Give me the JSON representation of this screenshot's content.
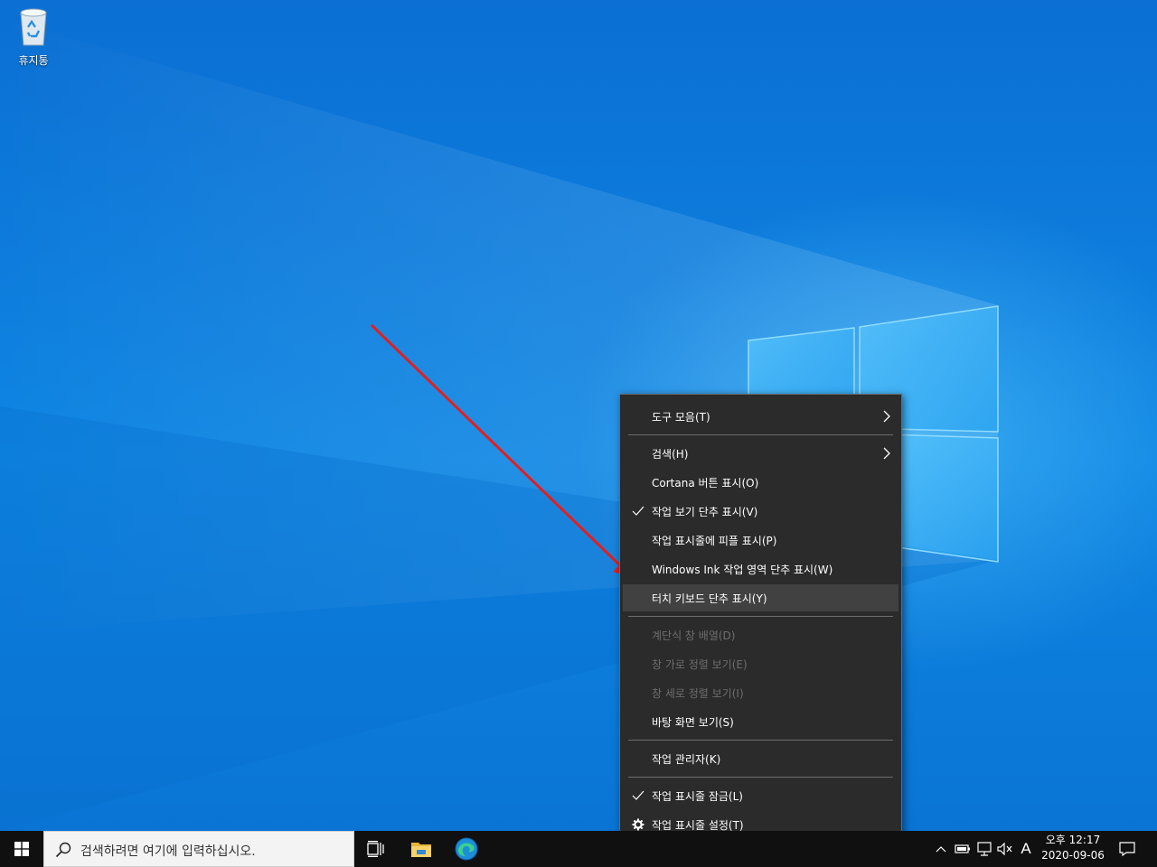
{
  "desktop": {
    "recycle_bin_label": "휴지통"
  },
  "context_menu": {
    "items": [
      {
        "label": "도구 모음(T)",
        "submenu": true
      },
      {
        "label": "검색(H)",
        "submenu": true
      },
      {
        "label": "Cortana 버튼 표시(O)"
      },
      {
        "label": "작업 보기 단추 표시(V)",
        "checked": true
      },
      {
        "label": "작업 표시줄에 피플 표시(P)"
      },
      {
        "label": "Windows Ink 작업 영역 단추 표시(W)"
      },
      {
        "label": "터치 키보드 단추 표시(Y)",
        "highlighted": true
      },
      {
        "label": "계단식 창 배열(D)",
        "disabled": true
      },
      {
        "label": "창 가로 정렬 보기(E)",
        "disabled": true
      },
      {
        "label": "창 세로 정렬 보기(I)",
        "disabled": true
      },
      {
        "label": "바탕 화면 보기(S)"
      },
      {
        "label": "작업 관리자(K)"
      },
      {
        "label": "작업 표시줄 잠금(L)",
        "checked": true
      },
      {
        "label": "작업 표시줄 설정(T)",
        "icon": "gear-icon"
      }
    ]
  },
  "taskbar": {
    "search_placeholder": "검색하려면 여기에 입력하십시오.",
    "pinned": [
      "task-view-icon",
      "file-explorer-icon",
      "edge-icon"
    ],
    "tray": {
      "ime_indicator": "A",
      "time": "오후 12:17",
      "date": "2020-09-06"
    }
  },
  "colors": {
    "menu_bg": "#2b2b2b",
    "menu_highlight": "#414141",
    "taskbar_bg": "#101010",
    "annotation_arrow": "#e02020"
  }
}
